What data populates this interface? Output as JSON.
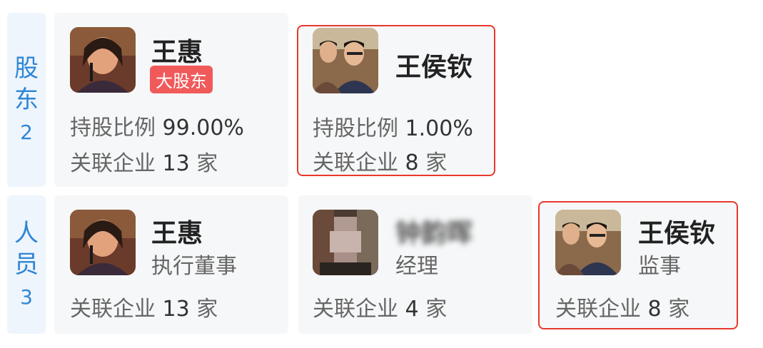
{
  "shareholders_section": {
    "tab_chars": [
      "股",
      "东"
    ],
    "count": "2",
    "cards": [
      {
        "name": "王惠",
        "badge": "大股东",
        "ratio_label": "持股比例",
        "ratio_value": "99.00%",
        "related_label": "关联企业",
        "related_count": "13",
        "related_unit": "家"
      },
      {
        "name": "王侯钦",
        "ratio_label": "持股比例",
        "ratio_value": "1.00%",
        "related_label": "关联企业",
        "related_count": "8",
        "related_unit": "家"
      }
    ]
  },
  "personnel_section": {
    "tab_chars": [
      "人",
      "员"
    ],
    "count": "3",
    "cards": [
      {
        "name": "王惠",
        "role": "执行董事",
        "related_label": "关联企业",
        "related_count": "13",
        "related_unit": "家"
      },
      {
        "name": "钟韵晖",
        "role": "经理",
        "related_label": "关联企业",
        "related_count": "4",
        "related_unit": "家"
      },
      {
        "name": "王侯钦",
        "role": "监事",
        "related_label": "关联企业",
        "related_count": "8",
        "related_unit": "家"
      }
    ]
  },
  "colors": {
    "tab_text": "#2f86d6",
    "tab_bg": "#eef5fc",
    "card_bg": "#f6f7f8",
    "highlight_border": "#e8382e",
    "badge_bg": "#f05a5a"
  }
}
